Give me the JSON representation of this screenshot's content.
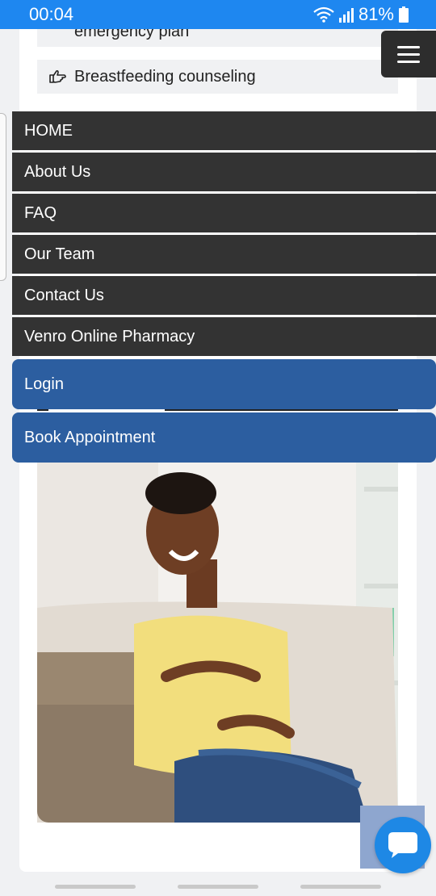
{
  "status_bar": {
    "time": "00:04",
    "battery": "81%"
  },
  "content": {
    "item_emergency": "emergency plan",
    "item_breastfeeding": "Breastfeeding counseling",
    "item_icon": "pointing-hand-icon"
  },
  "nav": {
    "items": [
      {
        "label": "HOME"
      },
      {
        "label": "About Us"
      },
      {
        "label": "FAQ"
      },
      {
        "label": "Our Team"
      },
      {
        "label": "Contact Us"
      },
      {
        "label": "Venro Online Pharmacy"
      }
    ],
    "login_label": "Login",
    "book_label": "Book Appointment"
  },
  "colors": {
    "status_bar": "#1e87f0",
    "nav_bg": "#333333",
    "button_bg": "#2c5ea0",
    "chat": "#1e88e5"
  }
}
